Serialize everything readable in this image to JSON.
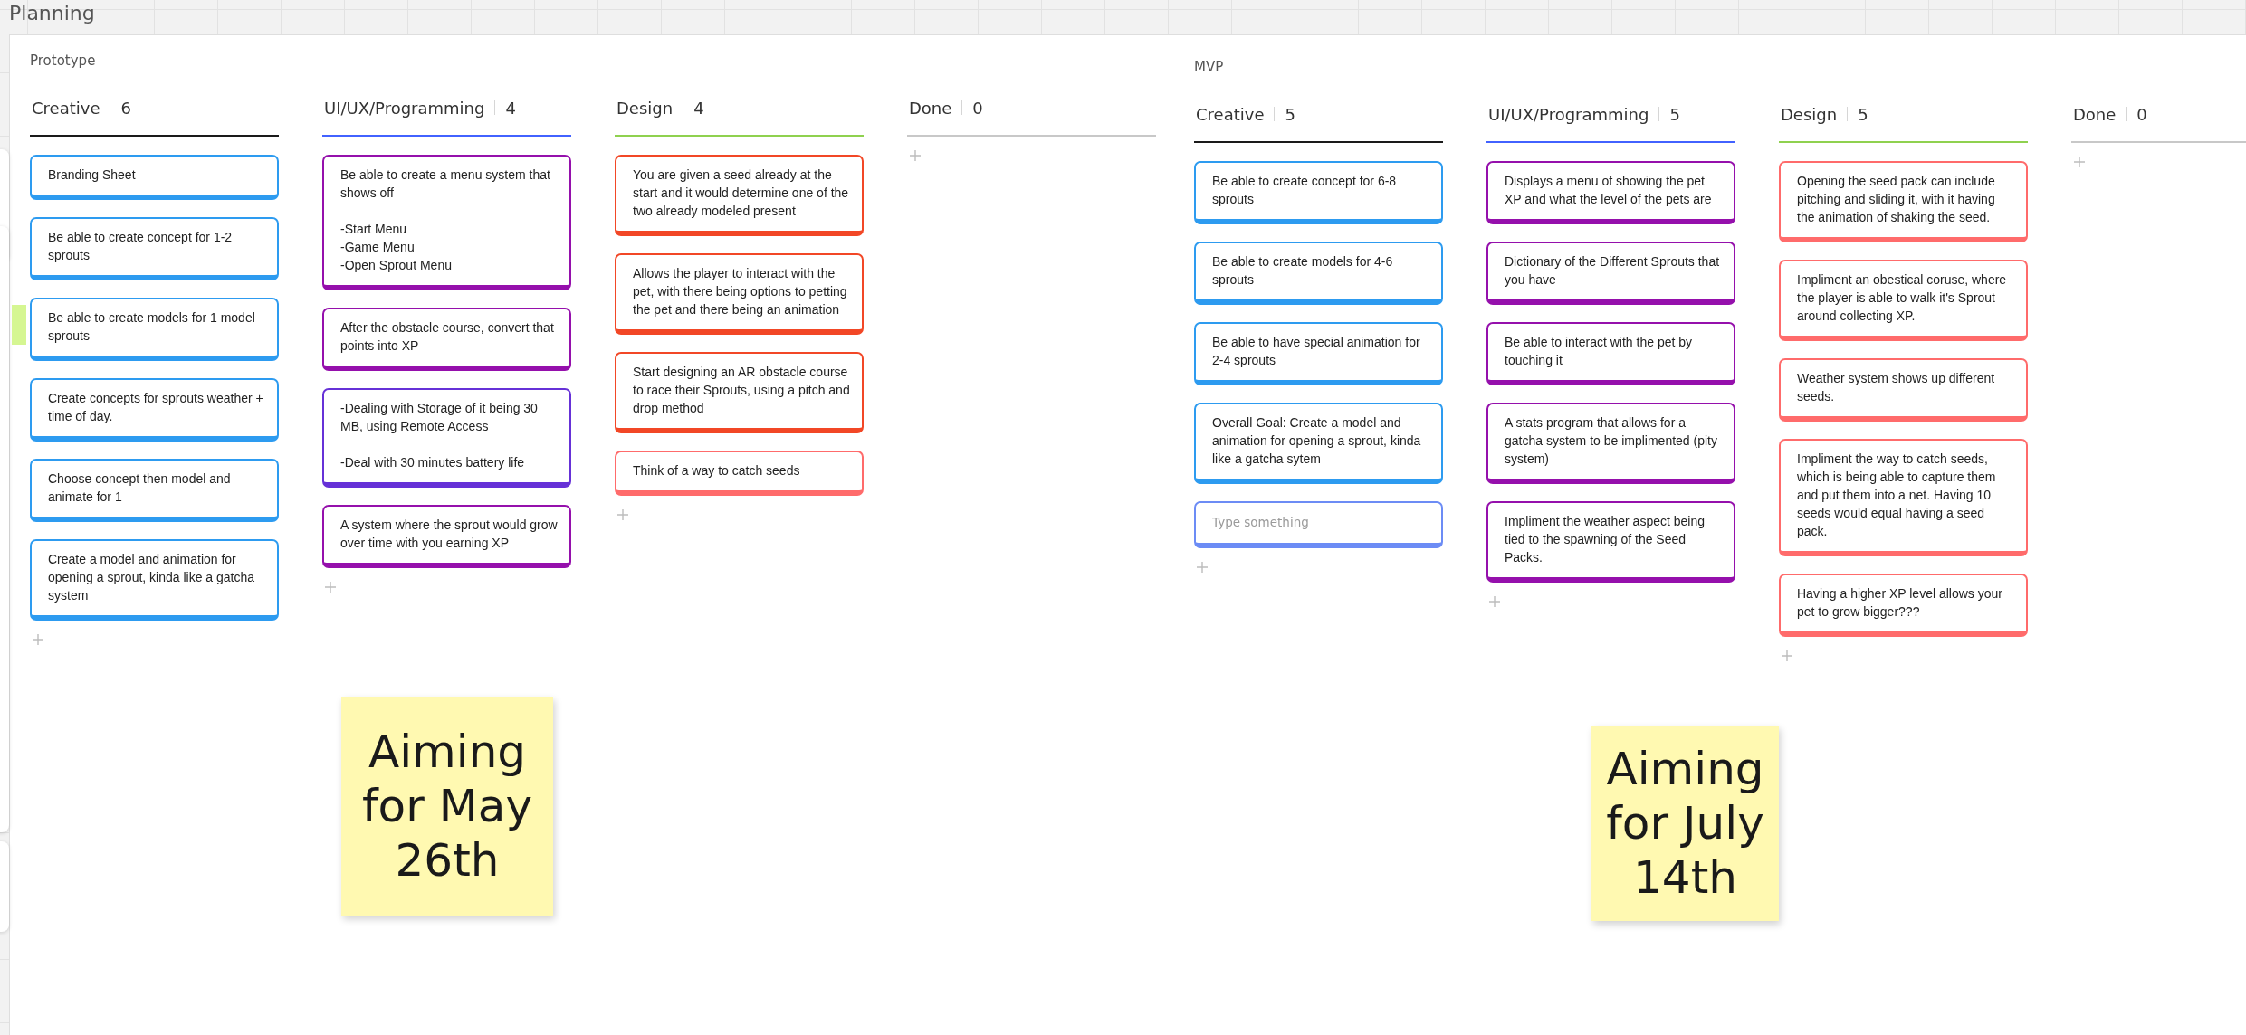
{
  "board_title": "Planning",
  "side_note": {
    "color": "#d5f692"
  },
  "frames": [
    {
      "title": "Prototype",
      "columns": [
        {
          "title": "Creative",
          "count": "6",
          "color": "#1a1a1a",
          "cards": [
            {
              "kind": "card",
              "text": "Branding Sheet",
              "color": "#2d9bf0"
            },
            {
              "kind": "card",
              "text": "Be able to create concept for 1-2 sprouts",
              "color": "#2d9bf0"
            },
            {
              "kind": "card",
              "text": "Be able to create models for 1 model sprouts",
              "color": "#2d9bf0"
            },
            {
              "kind": "card",
              "text": "Create concepts for sprouts weather + time of day.",
              "color": "#2d9bf0"
            },
            {
              "kind": "card",
              "text": "Choose concept then model and animate for 1",
              "color": "#2d9bf0"
            },
            {
              "kind": "card",
              "text": "Create a model and animation for opening a sprout, kinda like a gatcha system",
              "color": "#2d9bf0"
            }
          ]
        },
        {
          "title": "UI/UX/Programming",
          "count": "4",
          "color": "#4262ff",
          "cards": [
            {
              "kind": "card",
              "text": "Be able to create a menu system that shows off\n\n-Start Menu\n-Game Menu\n-Open Sprout Menu",
              "color": "#9510ac"
            },
            {
              "kind": "card",
              "text": "After the obstacle course, convert that points into XP",
              "color": "#9510ac"
            },
            {
              "kind": "card",
              "text": "-Dealing with Storage of it being 30 MB, using Remote Access\n\n-Deal with 30 minutes battery life",
              "color": "#6631d7"
            },
            {
              "kind": "card",
              "text": "A system where the sprout would grow over time with you earning XP",
              "color": "#9510ac"
            }
          ]
        },
        {
          "title": "Design",
          "count": "4",
          "color": "#8fd14f",
          "cards": [
            {
              "kind": "card",
              "text": "You are given a seed already at the start and it would determine one of the two already modeled present",
              "color": "#f24726"
            },
            {
              "kind": "card",
              "text": "Allows the player to interact with the pet, with there being options to petting the pet and there being an animation",
              "color": "#f24726"
            },
            {
              "kind": "card",
              "text": "Start designing an AR obstacle course to race their Sprouts, using a pitch and drop method",
              "color": "#f24726"
            },
            {
              "kind": "card",
              "text": "Think of a way to catch seeds",
              "color": "#ff6b6b"
            }
          ]
        },
        {
          "title": "Done",
          "count": "0",
          "color": "#c8c8c8"
        }
      ]
    },
    {
      "title": "MVP",
      "columns": [
        {
          "title": "Creative",
          "count": "5",
          "color": "#1a1a1a",
          "cards": [
            {
              "kind": "card",
              "text": "Be able to create concept for 6-8 sprouts",
              "color": "#2d9bf0"
            },
            {
              "kind": "card",
              "text": "Be able to create models for 4-6 sprouts",
              "color": "#2d9bf0"
            },
            {
              "kind": "card",
              "text": "Be able to have special animation for 2-4 sprouts",
              "color": "#2d9bf0"
            },
            {
              "kind": "card",
              "text": "Overall Goal: Create a model and animation for opening a sprout, kinda like a gatcha sytem",
              "color": "#2d9bf0"
            },
            {
              "kind": "input",
              "placeholder": "Type something",
              "color": "#6c8cf5"
            }
          ]
        },
        {
          "title": "UI/UX/Programming",
          "count": "5",
          "color": "#4262ff",
          "cards": [
            {
              "kind": "card",
              "text": "Displays a menu of showing the pet XP and what the level of the pets are",
              "color": "#9510ac"
            },
            {
              "kind": "card",
              "text": "Dictionary of the Different Sprouts that you have",
              "color": "#9510ac"
            },
            {
              "kind": "card",
              "text": "Be able to interact with the pet by touching it",
              "color": "#9510ac"
            },
            {
              "kind": "card",
              "text": "A stats program that allows for a gatcha system to be implimented (pity system)",
              "color": "#9510ac"
            },
            {
              "kind": "card",
              "text": "Impliment the weather aspect being tied to the spawning of the Seed Packs.",
              "color": "#9510ac"
            }
          ]
        },
        {
          "title": "Design",
          "count": "5",
          "color": "#8fd14f",
          "cards": [
            {
              "kind": "card",
              "text": "Opening the seed pack can include pitching and sliding it, with it having the animation of shaking the seed.",
              "color": "#ff6b6b"
            },
            {
              "kind": "card",
              "text": "Impliment an obestical coruse, where the player is able to walk it's Sprout around collecting XP.",
              "color": "#ff6b6b"
            },
            {
              "kind": "card",
              "text": "Weather system shows up different seeds.",
              "color": "#ff6b6b"
            },
            {
              "kind": "card",
              "text": "Impliment the way to catch seeds, which is being able to capture them and put them into a net. Having 10 seeds would equal having a seed pack.",
              "color": "#ff6b6b"
            },
            {
              "kind": "card",
              "text": "Having a higher XP level allows your pet to grow bigger???",
              "color": "#ff6b6b"
            }
          ]
        },
        {
          "title": "Done",
          "count": "0",
          "color": "#c8c8c8"
        }
      ]
    }
  ],
  "sticky_notes": [
    {
      "text": "Aiming for May 26th",
      "color": "#fff9b1"
    },
    {
      "text": "Aiming for July 14th",
      "color": "#fff9b1"
    }
  ]
}
